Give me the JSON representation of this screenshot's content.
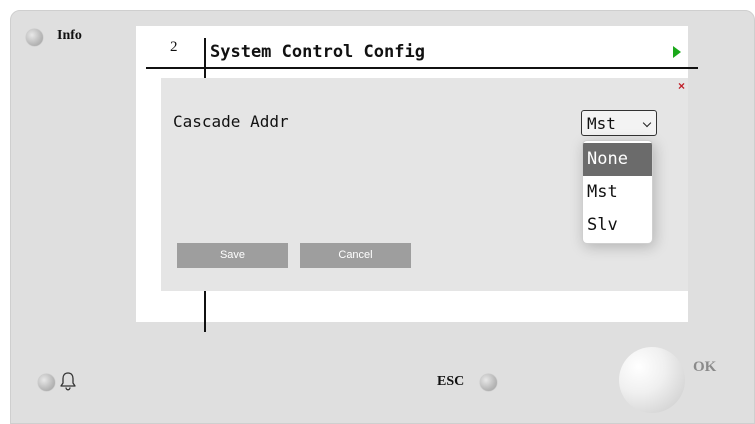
{
  "panel": {
    "info_label": "Info",
    "esc_label": "ESC",
    "ok_label": "OK"
  },
  "screen": {
    "line_number": "2",
    "title": "System Control Config"
  },
  "dialog": {
    "close_symbol": "×",
    "field_label": "Cascade Addr",
    "select": {
      "value": "Mst",
      "options": [
        "None",
        "Mst",
        "Slv"
      ],
      "highlighted": "None"
    },
    "save_label": "Save",
    "cancel_label": "Cancel"
  },
  "colors": {
    "play_arrow": "#1aa81a",
    "close_x": "#c0202a",
    "button_bg": "#9e9e9e",
    "option_highlight": "#6b6b6b"
  },
  "icons": [
    "info-led-icon",
    "play-arrow-icon",
    "close-icon",
    "bell-icon",
    "esc-led-icon",
    "ok-knob"
  ]
}
